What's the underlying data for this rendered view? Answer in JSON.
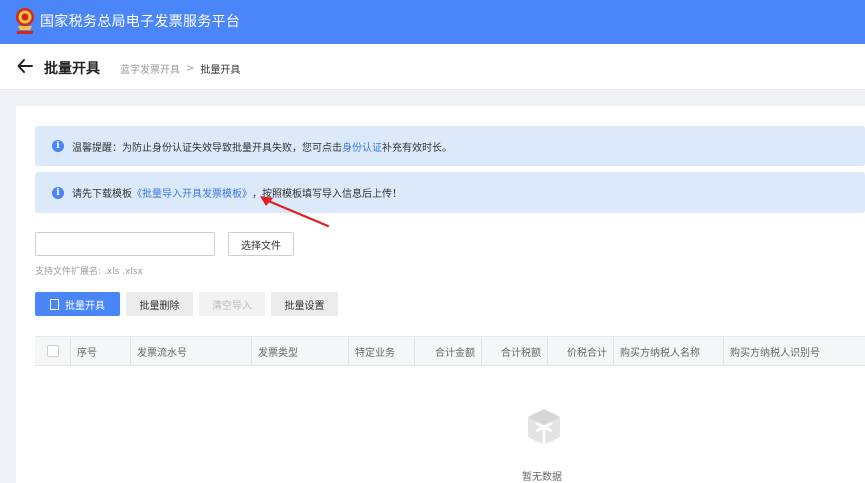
{
  "topbar": {
    "title": "国家税务总局电子发票服务平台"
  },
  "header": {
    "title": "批量开具",
    "breadcrumb": [
      "蓝字发票开具",
      "批量开具"
    ],
    "separator": ">"
  },
  "alerts": {
    "first": {
      "prefix": "温馨提醒：为防止身份认证失效导致批量开具失败，您可点击",
      "link": "身份认证",
      "suffix": "补充有效时长。"
    },
    "second": {
      "prefix": "请先下载模板",
      "link": "《批量导入开具发票模板》",
      "suffix": "，按照模板填写导入信息后上传！"
    }
  },
  "upload": {
    "file_value": "",
    "choose_label": "选择文件",
    "ext_hint": "支持文件扩展名: .xls .xlsx"
  },
  "toolbar": {
    "batch_issue": "批量开具",
    "batch_delete": "批量删除",
    "clear_import": "清空导入",
    "batch_settings": "批量设置"
  },
  "table": {
    "columns": [
      "序号",
      "发票流水号",
      "发票类型",
      "特定业务",
      "合计金额",
      "合计税额",
      "价税合计",
      "购买方纳税人名称",
      "购买方纳税人识别号"
    ],
    "empty_text": "暂无数据"
  },
  "colors": {
    "primary": "#4a86f7",
    "alert_bg": "#dbe9fb",
    "link": "#3a7ae0",
    "annotation": "#e02020"
  }
}
